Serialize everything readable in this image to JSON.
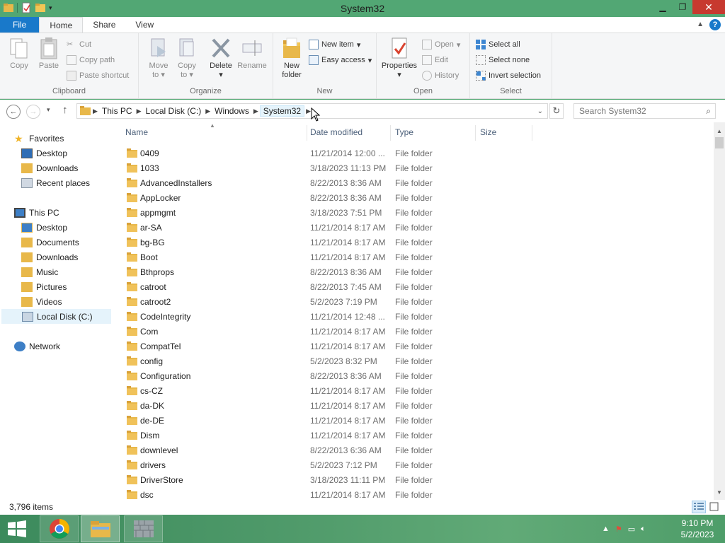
{
  "window": {
    "title": "System32"
  },
  "ribbon_tabs": [
    {
      "label": "File"
    },
    {
      "label": "Home"
    },
    {
      "label": "Share"
    },
    {
      "label": "View"
    }
  ],
  "ribbon": {
    "clipboard": {
      "label": "Clipboard",
      "copy": "Copy",
      "paste": "Paste",
      "cut": "Cut",
      "copy_path": "Copy path",
      "paste_shortcut": "Paste shortcut"
    },
    "organize": {
      "label": "Organize",
      "move_to_1": "Move",
      "move_to_2": "to",
      "copy_to_1": "Copy",
      "copy_to_2": "to",
      "delete": "Delete",
      "rename": "Rename"
    },
    "new": {
      "label": "New",
      "new_folder_1": "New",
      "new_folder_2": "folder",
      "new_item": "New item",
      "easy_access": "Easy access"
    },
    "open": {
      "label": "Open",
      "properties": "Properties",
      "open": "Open",
      "edit": "Edit",
      "history": "History"
    },
    "select": {
      "label": "Select",
      "select_all": "Select all",
      "select_none": "Select none",
      "invert": "Invert selection"
    }
  },
  "address": {
    "crumbs": [
      "This PC",
      "Local Disk (C:)",
      "Windows",
      "System32"
    ],
    "search_placeholder": "Search System32"
  },
  "nav": {
    "favorites": "Favorites",
    "fav_items": [
      "Desktop",
      "Downloads",
      "Recent places"
    ],
    "this_pc": "This PC",
    "pc_items": [
      "Desktop",
      "Documents",
      "Downloads",
      "Music",
      "Pictures",
      "Videos",
      "Local Disk (C:)"
    ],
    "network": "Network"
  },
  "columns": {
    "name": "Name",
    "date": "Date modified",
    "type": "Type",
    "size": "Size"
  },
  "files": [
    {
      "name": "0409",
      "date": "11/21/2014 12:00 ...",
      "type": "File folder"
    },
    {
      "name": "1033",
      "date": "3/18/2023 11:13 PM",
      "type": "File folder"
    },
    {
      "name": "AdvancedInstallers",
      "date": "8/22/2013 8:36 AM",
      "type": "File folder"
    },
    {
      "name": "AppLocker",
      "date": "8/22/2013 8:36 AM",
      "type": "File folder"
    },
    {
      "name": "appmgmt",
      "date": "3/18/2023 7:51 PM",
      "type": "File folder"
    },
    {
      "name": "ar-SA",
      "date": "11/21/2014 8:17 AM",
      "type": "File folder"
    },
    {
      "name": "bg-BG",
      "date": "11/21/2014 8:17 AM",
      "type": "File folder"
    },
    {
      "name": "Boot",
      "date": "11/21/2014 8:17 AM",
      "type": "File folder"
    },
    {
      "name": "Bthprops",
      "date": "8/22/2013 8:36 AM",
      "type": "File folder"
    },
    {
      "name": "catroot",
      "date": "8/22/2013 7:45 AM",
      "type": "File folder"
    },
    {
      "name": "catroot2",
      "date": "5/2/2023 7:19 PM",
      "type": "File folder"
    },
    {
      "name": "CodeIntegrity",
      "date": "11/21/2014 12:48 ...",
      "type": "File folder"
    },
    {
      "name": "Com",
      "date": "11/21/2014 8:17 AM",
      "type": "File folder"
    },
    {
      "name": "CompatTel",
      "date": "11/21/2014 8:17 AM",
      "type": "File folder"
    },
    {
      "name": "config",
      "date": "5/2/2023 8:32 PM",
      "type": "File folder"
    },
    {
      "name": "Configuration",
      "date": "8/22/2013 8:36 AM",
      "type": "File folder"
    },
    {
      "name": "cs-CZ",
      "date": "11/21/2014 8:17 AM",
      "type": "File folder"
    },
    {
      "name": "da-DK",
      "date": "11/21/2014 8:17 AM",
      "type": "File folder"
    },
    {
      "name": "de-DE",
      "date": "11/21/2014 8:17 AM",
      "type": "File folder"
    },
    {
      "name": "Dism",
      "date": "11/21/2014 8:17 AM",
      "type": "File folder"
    },
    {
      "name": "downlevel",
      "date": "8/22/2013 6:36 AM",
      "type": "File folder"
    },
    {
      "name": "drivers",
      "date": "5/2/2023 7:12 PM",
      "type": "File folder"
    },
    {
      "name": "DriverStore",
      "date": "3/18/2023 11:11 PM",
      "type": "File folder"
    },
    {
      "name": "dsc",
      "date": "11/21/2014 8:17 AM",
      "type": "File folder"
    }
  ],
  "status": {
    "count": "3,796 items"
  },
  "clock": {
    "time": "9:10 PM",
    "date": "5/2/2023"
  },
  "colors": {
    "accent": "#1979ca",
    "titlebar": "#52a774",
    "close": "#c7392f",
    "folder": "#e8b84a"
  }
}
